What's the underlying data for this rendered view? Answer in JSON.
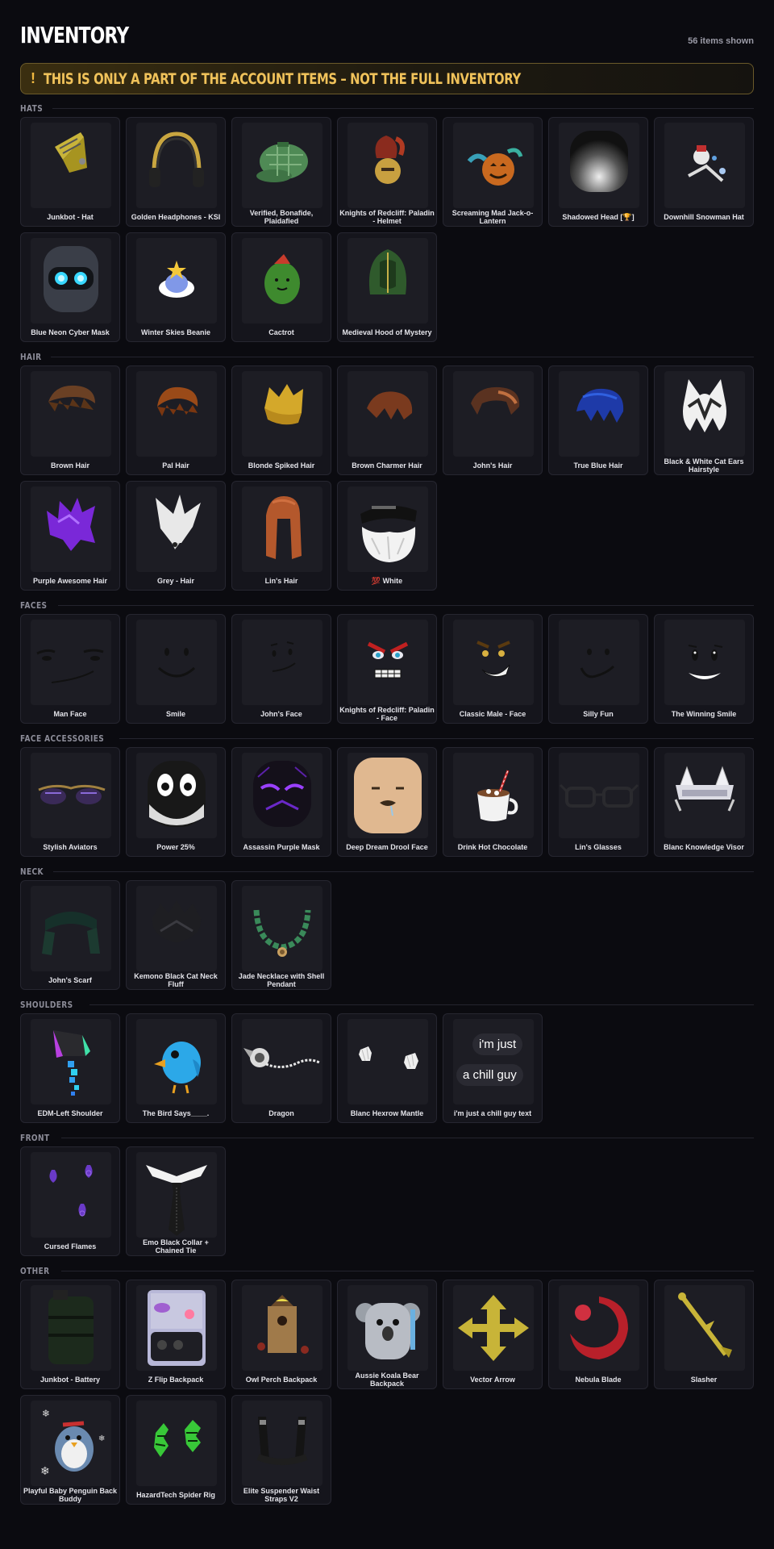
{
  "page": {
    "title": "INVENTORY",
    "count": "56 items shown",
    "banner_icon": "!",
    "banner": "THIS IS ONLY A PART OF THE ACCOUNT ITEMS – NOT THE FULL INVENTORY"
  },
  "colors": {
    "background": "#0b0b10",
    "card": "#15151c",
    "accent": "#f0c25a"
  },
  "sections": [
    {
      "title": "HATS",
      "items": [
        {
          "name": "Junkbot - Hat",
          "icon": "junkbot-hat-icon"
        },
        {
          "name": "Golden Headphones - KSI",
          "icon": "headphones-icon"
        },
        {
          "name": "Verified, Bonafide, Plaidafied",
          "icon": "plaid-cap-icon"
        },
        {
          "name": "Knights of Redcliff: Paladin - Helmet",
          "icon": "paladin-helmet-icon"
        },
        {
          "name": "Screaming Mad Jack-o-Lantern",
          "icon": "jack-o-lantern-icon"
        },
        {
          "name": "Shadowed Head [🏆]",
          "icon": "shadowed-head-icon"
        },
        {
          "name": "Downhill Snowman Hat",
          "icon": "snowman-hat-icon"
        },
        {
          "name": "Blue Neon Cyber Mask",
          "icon": "cyber-mask-icon"
        },
        {
          "name": "Winter Skies Beanie",
          "icon": "cloud-beanie-icon"
        },
        {
          "name": "Cactrot",
          "icon": "cactus-icon"
        },
        {
          "name": "Medieval Hood of Mystery",
          "icon": "hood-icon"
        }
      ]
    },
    {
      "title": "HAIR",
      "items": [
        {
          "name": "Brown Hair",
          "icon": "brown-hair-icon"
        },
        {
          "name": "Pal Hair",
          "icon": "pal-hair-icon"
        },
        {
          "name": "Blonde Spiked Hair",
          "icon": "blonde-hair-icon"
        },
        {
          "name": "Brown Charmer Hair",
          "icon": "charmer-hair-icon"
        },
        {
          "name": "John's Hair",
          "icon": "johns-hair-icon"
        },
        {
          "name": "True Blue Hair",
          "icon": "blue-hair-icon"
        },
        {
          "name": "Black & White Cat Ears Hairstyle",
          "icon": "cat-ears-hair-icon"
        },
        {
          "name": "Purple Awesome Hair",
          "icon": "purple-hair-icon"
        },
        {
          "name": "Grey - Hair",
          "icon": "grey-hair-icon"
        },
        {
          "name": "Lin's Hair",
          "icon": "lins-hair-icon"
        },
        {
          "name": "💯 White",
          "icon": "white-beard-icon"
        }
      ]
    },
    {
      "title": "FACES",
      "items": [
        {
          "name": "Man Face",
          "icon": "man-face-icon"
        },
        {
          "name": "Smile",
          "icon": "smile-face-icon"
        },
        {
          "name": "John's Face",
          "icon": "johns-face-icon"
        },
        {
          "name": "Knights of Redcliff: Paladin - Face",
          "icon": "paladin-face-icon"
        },
        {
          "name": "Classic Male - Face",
          "icon": "classic-male-face-icon"
        },
        {
          "name": "Silly Fun",
          "icon": "silly-fun-face-icon"
        },
        {
          "name": "The Winning Smile",
          "icon": "winning-smile-icon"
        }
      ]
    },
    {
      "title": "FACE ACCESSORIES",
      "items": [
        {
          "name": "Stylish Aviators",
          "icon": "aviators-icon"
        },
        {
          "name": "Power 25%",
          "icon": "power-mask-icon"
        },
        {
          "name": "Assassin Purple Mask",
          "icon": "assassin-mask-icon"
        },
        {
          "name": "Deep Dream Drool Face",
          "icon": "drool-face-icon"
        },
        {
          "name": "Drink Hot Chocolate",
          "icon": "hot-chocolate-icon"
        },
        {
          "name": "Lin's Glasses",
          "icon": "glasses-icon"
        },
        {
          "name": "Blanc Knowledge Visor",
          "icon": "visor-icon"
        }
      ]
    },
    {
      "title": "NECK",
      "items": [
        {
          "name": "John's Scarf",
          "icon": "scarf-icon"
        },
        {
          "name": "Kemono Black Cat Neck Fluff",
          "icon": "neck-fluff-icon"
        },
        {
          "name": "Jade Necklace with Shell Pendant",
          "icon": "necklace-icon"
        }
      ]
    },
    {
      "title": "SHOULDERS",
      "items": [
        {
          "name": "EDM-Left Shoulder",
          "icon": "edm-shoulder-icon"
        },
        {
          "name": "The Bird Says____.",
          "icon": "blue-bird-icon"
        },
        {
          "name": "Dragon",
          "icon": "dragon-icon"
        },
        {
          "name": "Blanc Hexrow Mantle",
          "icon": "mantle-icon"
        },
        {
          "name": "i'm just a chill guy text",
          "icon": "chill-guy-text-icon",
          "bubbles": [
            "i'm just",
            "a chill guy"
          ]
        }
      ]
    },
    {
      "title": "FRONT",
      "items": [
        {
          "name": "Cursed Flames",
          "icon": "cursed-flames-icon"
        },
        {
          "name": "Emo Black Collar + Chained Tie",
          "icon": "collar-tie-icon"
        }
      ]
    },
    {
      "title": "OTHER",
      "items": [
        {
          "name": "Junkbot - Battery",
          "icon": "battery-icon"
        },
        {
          "name": "Z Flip Backpack",
          "icon": "phone-backpack-icon"
        },
        {
          "name": "Owl Perch Backpack",
          "icon": "owl-backpack-icon"
        },
        {
          "name": "Aussie Koala Bear Backpack",
          "icon": "koala-backpack-icon"
        },
        {
          "name": "Vector Arrow",
          "icon": "vector-arrow-icon"
        },
        {
          "name": "Nebula Blade",
          "icon": "nebula-blade-icon"
        },
        {
          "name": "Slasher",
          "icon": "slasher-icon"
        },
        {
          "name": "Playful Baby Penguin Back Buddy",
          "icon": "penguin-icon"
        },
        {
          "name": "HazardTech Spider Rig",
          "icon": "spider-rig-icon"
        },
        {
          "name": "Elite Suspender Waist Straps V2",
          "icon": "suspenders-icon"
        }
      ]
    }
  ]
}
